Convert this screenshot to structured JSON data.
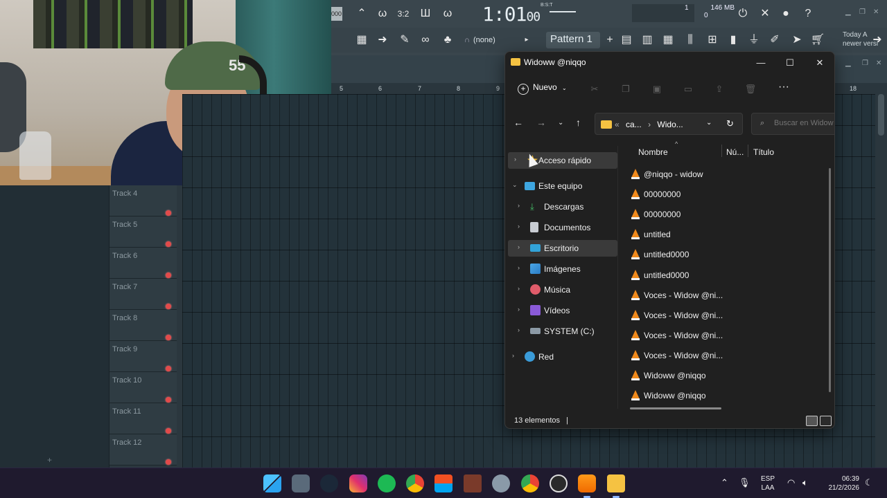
{
  "fl_studio": {
    "time_main": "1:01",
    "time_sub": "00",
    "time_label": "B:S:T",
    "cpu_value": "1",
    "memory": "146 MB",
    "memory_sub": "0",
    "bpm_stub": "000",
    "snap_value": "(none)",
    "pattern_label": "Pattern 1",
    "news_line1": "Today  A",
    "news_line2": "newer versi",
    "ruler": [
      "5",
      "6",
      "7",
      "8",
      "9",
      "18"
    ],
    "tracks": [
      "Track 4",
      "Track 5",
      "Track 6",
      "Track 7",
      "Track 8",
      "Track 9",
      "Track 10",
      "Track 11",
      "Track 12"
    ]
  },
  "webcam": {
    "cap_text": "55"
  },
  "explorer": {
    "title": "Widoww @niqqo",
    "new_button": "Nuevo",
    "address_prefix": "«",
    "address_crumbs": [
      "ca...",
      "Wido..."
    ],
    "search_placeholder": "Buscar en Widow",
    "nav": {
      "quick_access": "Acceso rápido",
      "this_pc": "Este equipo",
      "downloads": "Descargas",
      "documents": "Documentos",
      "desktop": "Escritorio",
      "images": "Imágenes",
      "music": "Música",
      "videos": "Vídeos",
      "system_drive": "SYSTEM (C:)",
      "network": "Red"
    },
    "columns": {
      "name": "Nombre",
      "number": "Nú...",
      "title": "Título"
    },
    "files": [
      "@niqqo - widow",
      "00000000",
      "00000000",
      "untitled",
      "untitled0000",
      "untitled0000",
      "Voces - Widow @ni...",
      "Voces - Widow @ni...",
      "Voces - Widow @ni...",
      "Voces - Widow @ni...",
      "Widoww @niqqo",
      "Widoww @niqqo"
    ],
    "status": "13 elementos"
  },
  "taskbar": {
    "lang_line1": "ESP",
    "lang_line2": "LAA",
    "time": "06:39",
    "date": "21/2/2026"
  }
}
